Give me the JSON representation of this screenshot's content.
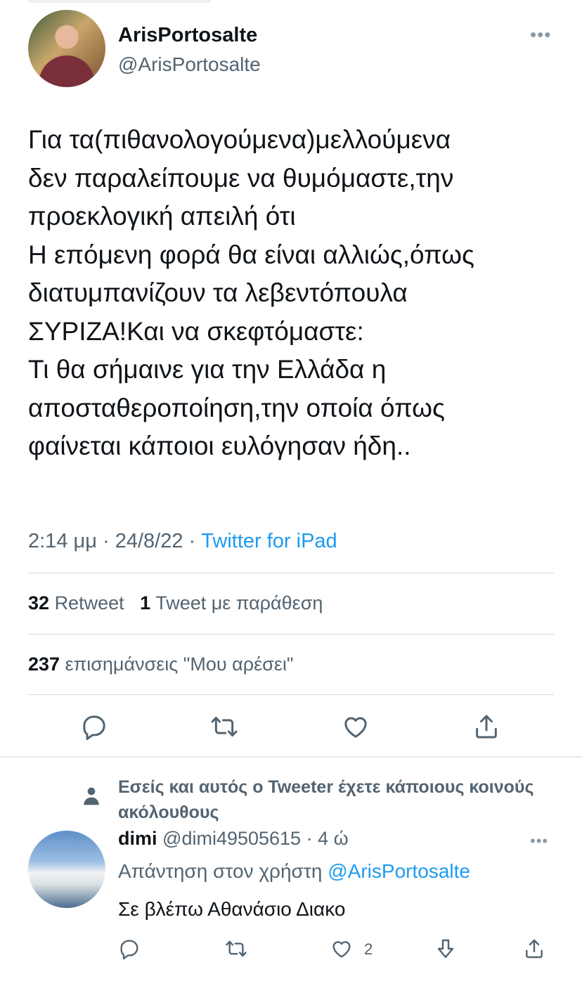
{
  "tweet": {
    "display_name": "ArisPortosalte",
    "handle": "@ArisPortosalte",
    "text": "Για τα(πιθανολογούμενα)μελλούμενα\nδεν παραλείπουμε να θυμόμαστε,την\nπροεκλογική απειλή ότι\nΗ επόμενη φορά θα είναι αλλιώς,όπως\nδιατυμπανίζουν τα λεβεντόπουλα\nΣΥΡΙΖΑ!Και να σκεφτόμαστε:\nΤι θα σήμαινε για την Ελλάδα η\nαποσταθεροποίηση,την οποία όπως\nφαίνεται κάποιοι ευλόγησαν ήδη..",
    "time": "2:14 μμ",
    "dot": "·",
    "date": "24/8/22",
    "source": "Twitter for iPad",
    "retweets_count": "32",
    "retweets_label": "Retweet",
    "quotes_count": "1",
    "quotes_label": "Tweet με παράθεση",
    "likes_count": "237",
    "likes_label": "επισημάνσεις \"Μου αρέσει\"",
    "more_icon": "more-horizontal-icon"
  },
  "actions": [
    "reply-icon",
    "retweet-icon",
    "like-icon",
    "share-icon"
  ],
  "reply": {
    "social_context": "Εσείς και αυτός ο Tweeter έχετε κάποιους κοινούς ακόλουθους",
    "display_name": "dimi",
    "handle": "@dimi49505615",
    "dot": "·",
    "time": "4 ώ",
    "replying_to_label": "Απάντηση στον χρήστη",
    "replying_to_handle": "@ArisPortosalte",
    "text": "Σε βλέπω Αθανάσιο Διακο",
    "like_count": "2"
  },
  "colors": {
    "text": "#0f1419",
    "muted": "#536471",
    "link": "#1d9bf0",
    "divider": "#cfd9de"
  }
}
